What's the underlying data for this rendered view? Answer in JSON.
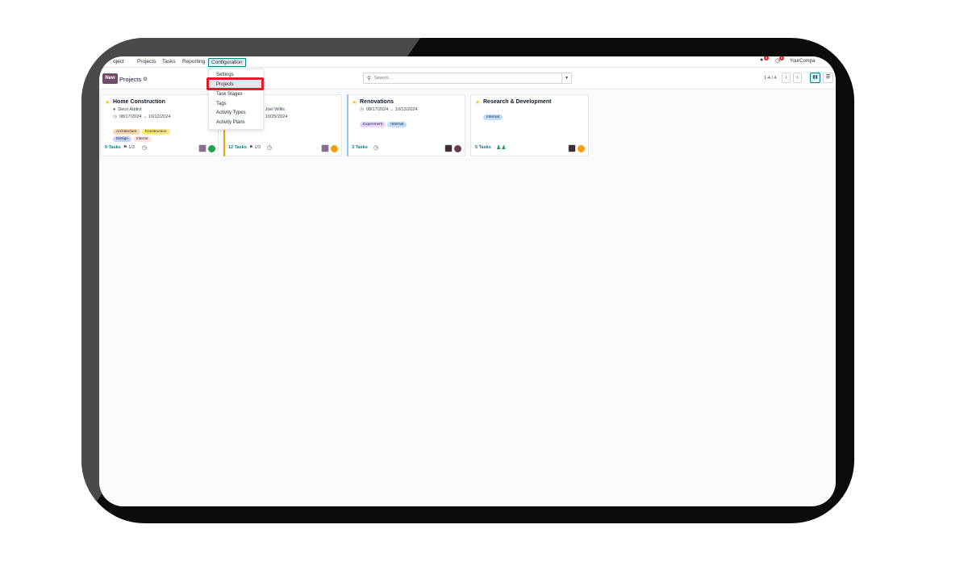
{
  "nav": {
    "app_name": "oject",
    "items": [
      "Projects",
      "Tasks",
      "Reporting",
      "Configuration"
    ],
    "chat_count": "8",
    "activity_count": "8",
    "company": "YourCompa"
  },
  "control": {
    "new_label": "New",
    "title": "Projects",
    "search_placeholder": "Search...",
    "pager": "1-4 / 4"
  },
  "config_menu": {
    "items": [
      "Settings",
      "Projects",
      "Task Stages",
      "Tags",
      "Activity Types",
      "Activity Plans"
    ],
    "highlighted": "Projects"
  },
  "projects": [
    {
      "name": "Home Construction",
      "customer": "Deco Addict",
      "dates": "08/17/2024  →  10/12/2024",
      "tags": [
        {
          "label": "Architecture",
          "color": "#f9d9b3"
        },
        {
          "label": "Construction",
          "color": "#fde68a"
        },
        {
          "label": "Design",
          "color": "#c7d2fe"
        },
        {
          "label": "Interior",
          "color": "#fee2e2"
        }
      ],
      "tasks": "0 Tasks",
      "milestones": "1/3",
      "status_color": "#22a34a",
      "bar_color": "#ffffff"
    },
    {
      "name": "ign",
      "customer": "pany, Joel Willis",
      "dates": "24  →  10/25/2024",
      "tags": [],
      "tasks": "12 Tasks",
      "milestones": "1/3",
      "status_color": "#f59e0b",
      "bar_color": "#f59e0b"
    },
    {
      "name": "Renovations",
      "customer": "",
      "dates": "08/17/2024  →  10/12/2024",
      "tags": [
        {
          "label": "Experiment",
          "color": "#e9d5ff"
        },
        {
          "label": "Internal",
          "color": "#bfdbfe"
        }
      ],
      "tasks": "3 Tasks",
      "milestones": "",
      "status_color": "#6b3b55",
      "bar_color": "#93c5fd"
    },
    {
      "name": "Research & Development",
      "customer": "",
      "dates": "",
      "tags": [
        {
          "label": "Internal",
          "color": "#bfdbfe"
        }
      ],
      "tasks": "5 Tasks",
      "milestones": "",
      "status_color": "#f59e0b",
      "bar_color": "#ffffff"
    }
  ]
}
